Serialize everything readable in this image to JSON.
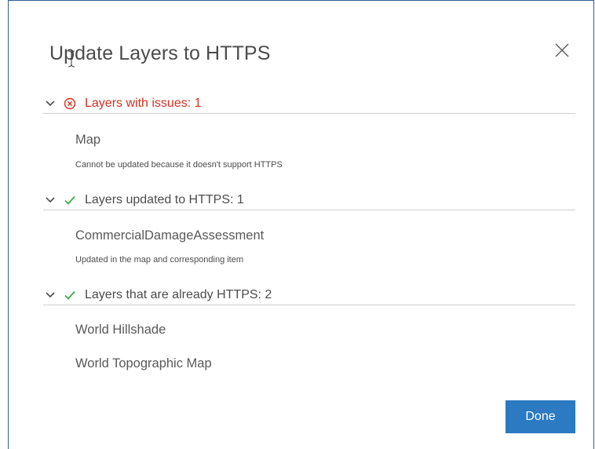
{
  "dialog": {
    "title": "Update Layers to HTTPS",
    "done_label": "Done"
  },
  "sections": [
    {
      "label": "Layers with issues: 1",
      "status": "error-circle-icon",
      "items": [
        {
          "name": "Map",
          "description": "Cannot be updated because it doesn't support HTTPS"
        }
      ]
    },
    {
      "label": "Layers updated to HTTPS: 1",
      "status": "check-icon",
      "items": [
        {
          "name": "CommercialDamageAssessment",
          "description": "Updated in the map and corresponding item"
        }
      ]
    },
    {
      "label": "Layers that are already HTTPS: 2",
      "status": "check-icon",
      "items": [
        {
          "name": "World Hillshade"
        },
        {
          "name": "World Topographic Map"
        }
      ]
    }
  ],
  "colors": {
    "error": "#d83020",
    "success": "#35ac46",
    "primary": "#2b7ac2",
    "text": "#4c4c4c"
  }
}
